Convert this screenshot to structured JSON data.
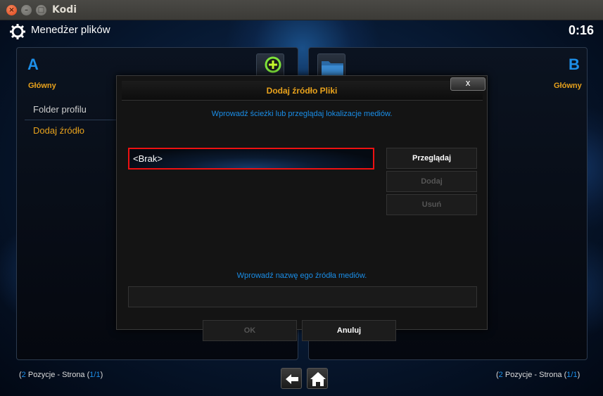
{
  "window": {
    "title": "Kodi"
  },
  "header": {
    "title": "Menedżer plików",
    "clock": "0:16"
  },
  "left_panel": {
    "letter": "A",
    "subtitle": "Główny",
    "items": [
      {
        "label": "Folder profilu"
      },
      {
        "label": "Dodaj źródło"
      }
    ]
  },
  "right_panel": {
    "letter": "B",
    "subtitle": "Główny"
  },
  "dialog": {
    "title": "Dodaj źródło Pliki",
    "close_label": "x",
    "path_hint": "Wprowadź ścieżki lub przeglądaj lokalizacje mediów.",
    "path_value": "<Brak>",
    "browse_label": "Przeglądaj",
    "add_label": "Dodaj",
    "remove_label": "Usuń",
    "name_hint": "Wprowadź nazwę ego źródła mediów.",
    "name_value": "",
    "ok_label": "OK",
    "cancel_label": "Anuluj"
  },
  "footer": {
    "left": {
      "count": "2",
      "text": " Pozycje - Strona ",
      "page": "1/1"
    },
    "right": {
      "count": "2",
      "text": " Pozycje - Strona ",
      "page": "1/1"
    }
  },
  "colors": {
    "accent": "#1d8fe8",
    "highlight": "#e8a21c",
    "focus_border": "#e11111"
  }
}
